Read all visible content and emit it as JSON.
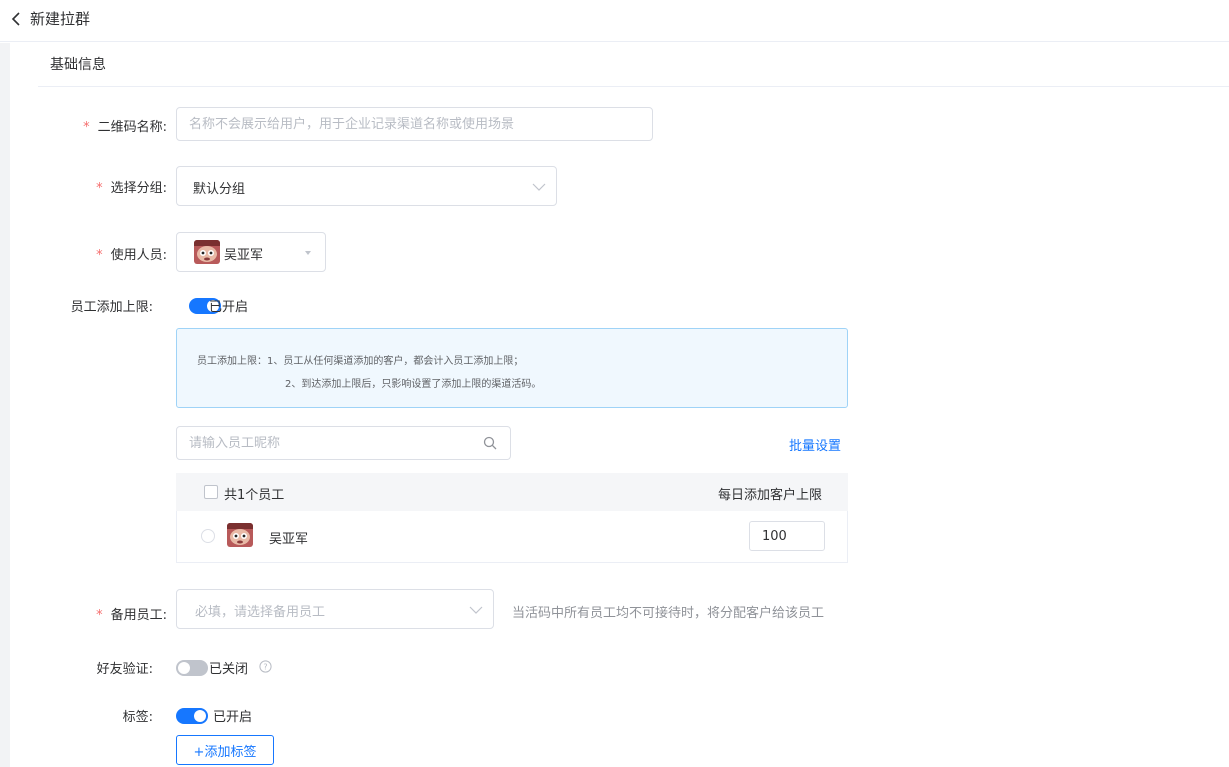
{
  "header": {
    "title": "新建拉群"
  },
  "section": {
    "title": "基础信息"
  },
  "colors": {
    "accent": "#1677ff",
    "required": "#f56c6c",
    "tip_bg": "#f0f8fe",
    "tip_border": "#9fd3f7"
  },
  "form": {
    "qr_name": {
      "label": "二维码名称:",
      "placeholder": "名称不会展示给用户，用于企业记录渠道名称或使用场景",
      "value": ""
    },
    "group": {
      "label": "选择分组:",
      "value": "默认分组"
    },
    "staff": {
      "label": "使用人员:",
      "value": "吴亚军"
    },
    "add_limit": {
      "label": "员工添加上限:",
      "enabled": true,
      "state_text": "已开启",
      "tip_line1": "员工添加上限：1、员工从任何渠道添加的客户，都会计入员工添加上限；",
      "tip_line2": "2、到达添加上限后，只影响设置了添加上限的渠道活码。",
      "search_placeholder": "请输入员工昵称",
      "batch_link": "批量设置",
      "table": {
        "header_count": "共1个员工",
        "header_limit": "每日添加客户上限",
        "rows": [
          {
            "name": "吴亚军",
            "limit": "100"
          }
        ]
      }
    },
    "backup": {
      "label": "备用员工:",
      "placeholder": "必填，请选择备用员工",
      "hint": "当活码中所有员工均不可接待时，将分配客户给该员工"
    },
    "friend_verify": {
      "label": "好友验证:",
      "enabled": false,
      "state_text": "已关闭"
    },
    "tags": {
      "label": "标签:",
      "enabled": true,
      "state_text": "已开启",
      "add_button": "+添加标签"
    }
  }
}
